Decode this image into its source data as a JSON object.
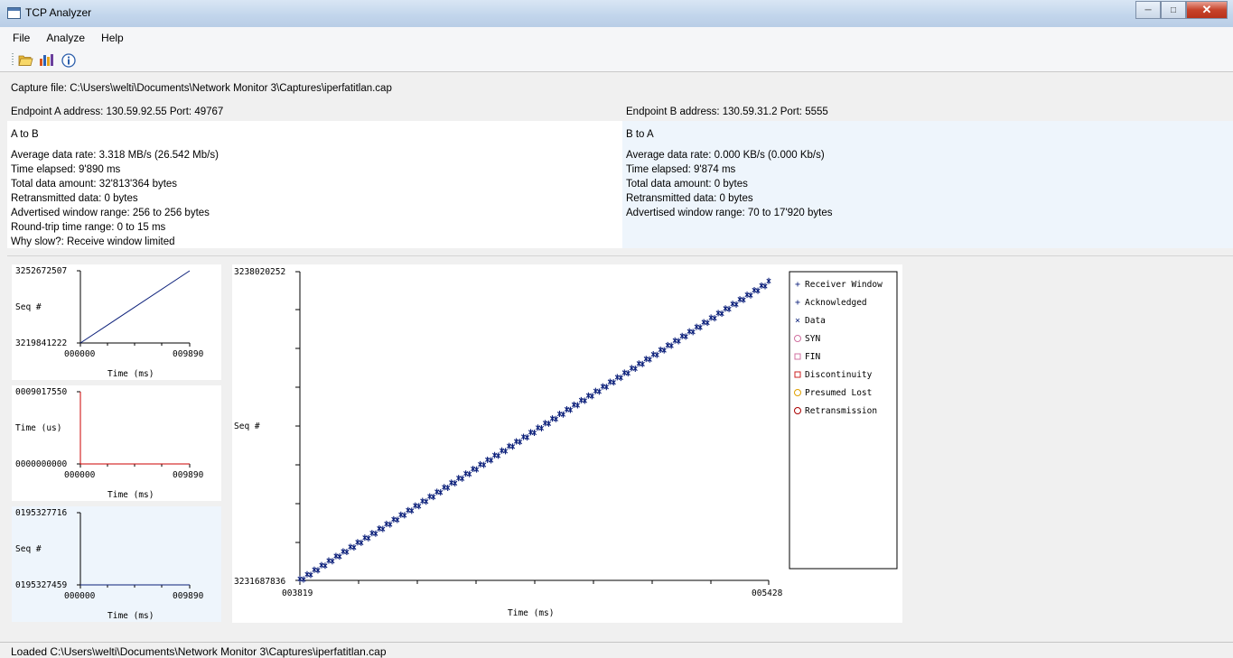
{
  "window": {
    "title": "TCP Analyzer"
  },
  "menu": {
    "items": [
      "File",
      "Analyze",
      "Help"
    ]
  },
  "capture": {
    "label": "Capture file:",
    "path": "C:\\Users\\welti\\Documents\\Network Monitor 3\\Captures\\iperfatitlan.cap"
  },
  "endpoint_a": {
    "text": "Endpoint A address: 130.59.92.55 Port: 49767"
  },
  "endpoint_b": {
    "text": "Endpoint B address: 130.59.31.2 Port: 5555"
  },
  "a_to_b": {
    "title": "A to B",
    "lines": [
      "Average data rate: 3.318 MB/s (26.542 Mb/s)",
      "Time elapsed: 9'890 ms",
      "Total data amount: 32'813'364 bytes",
      "Retransmitted data: 0 bytes",
      "Advertised window range: 256 to 256 bytes",
      "Round-trip time range: 0 to 15 ms",
      "Why slow?: Receive window limited"
    ]
  },
  "b_to_a": {
    "title": "B to A",
    "lines": [
      "Average data rate: 0.000 KB/s (0.000 Kb/s)",
      "Time elapsed: 9'874 ms",
      "Total data amount: 0 bytes",
      "Retransmitted data: 0 bytes",
      "Advertised window range: 70 to 17'920 bytes"
    ]
  },
  "colors": {
    "series": "#0b1f7a",
    "rtt": "#cc0000",
    "highlight_bg": "#eef5fc"
  },
  "chart_data": [
    {
      "type": "line",
      "name_key": "mini-seq-chart",
      "ylabel": "Seq #",
      "xlabel": "Time (ms)",
      "ytick_labels": [
        "3252672507",
        "3219841222"
      ],
      "xtick_labels": [
        "000000",
        "009890"
      ],
      "ylim": [
        3219841222,
        3252672507
      ],
      "xlim": [
        0,
        9890
      ],
      "x": [
        0,
        9890
      ],
      "y": [
        3219841222,
        3252672507
      ]
    },
    {
      "type": "line",
      "name_key": "mini-rtt-chart",
      "ylabel": "Time (us)",
      "xlabel": "Time (ms)",
      "ytick_labels": [
        "0009017550",
        "0000000000"
      ],
      "xtick_labels": [
        "000000",
        "009890"
      ],
      "ylim": [
        0,
        9017550
      ],
      "xlim": [
        0,
        9890
      ],
      "x": [
        0,
        0,
        9890
      ],
      "y": [
        9017550,
        0,
        0
      ]
    },
    {
      "type": "line",
      "name_key": "mini-b-seq-chart",
      "ylabel": "Seq #",
      "xlabel": "Time (ms)",
      "ytick_labels": [
        "0195327716",
        "0195327459"
      ],
      "xtick_labels": [
        "000000",
        "009890"
      ],
      "ylim": [
        195327459,
        195327716
      ],
      "xlim": [
        0,
        9890
      ],
      "x": [
        0,
        9890
      ],
      "y": [
        195327459,
        195327459
      ]
    },
    {
      "type": "scatter",
      "name_key": "main-seq-chart",
      "ylabel": "Seq #",
      "xlabel": "Time (ms)",
      "ytick_labels": [
        "3238020252",
        "3231687836"
      ],
      "xtick_labels": [
        "003819",
        "005428"
      ],
      "ylim": [
        3231687836,
        3238020252
      ],
      "xlim": [
        3819,
        5428
      ],
      "x": [
        3819,
        5428
      ],
      "y": [
        3231688500,
        3237800000
      ],
      "legend": [
        "Receiver Window",
        "Acknowledged",
        "Data",
        "SYN",
        "FIN",
        "Discontinuity",
        "Presumed Lost",
        "Retransmission"
      ],
      "legend_placement": "right"
    }
  ],
  "status": {
    "text": "Loaded C:\\Users\\welti\\Documents\\Network Monitor 3\\Captures\\iperfatitlan.cap"
  }
}
